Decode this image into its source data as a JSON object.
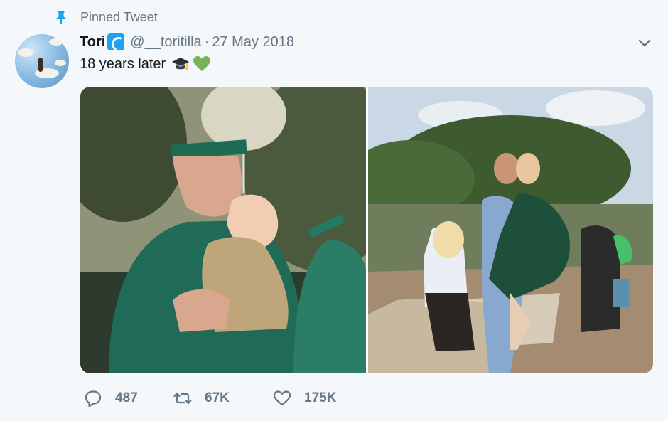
{
  "pinned": {
    "label": "Pinned Tweet",
    "icon": "pin-icon"
  },
  "author": {
    "display_name": "Tori",
    "name_emoji": "water-wave-emoji",
    "handle": "@__toritilla"
  },
  "date_separator": "·",
  "date": "27 May 2018",
  "tweet": {
    "text": "18 years later",
    "emojis": [
      "graduation-cap-emoji",
      "green-heart-emoji"
    ]
  },
  "media": {
    "photos": [
      "graduation-photo-2000",
      "graduation-photo-2018"
    ]
  },
  "actions": {
    "reply": {
      "icon": "reply-icon",
      "count": "487"
    },
    "retweet": {
      "icon": "retweet-icon",
      "count": "67K"
    },
    "like": {
      "icon": "heart-icon",
      "count": "175K"
    }
  },
  "menu": {
    "icon": "chevron-down-icon"
  },
  "colors": {
    "accent": "#1da1f2",
    "secondary_text": "#657786",
    "background": "#f5f8fa",
    "heart_emoji": "#78b159"
  }
}
